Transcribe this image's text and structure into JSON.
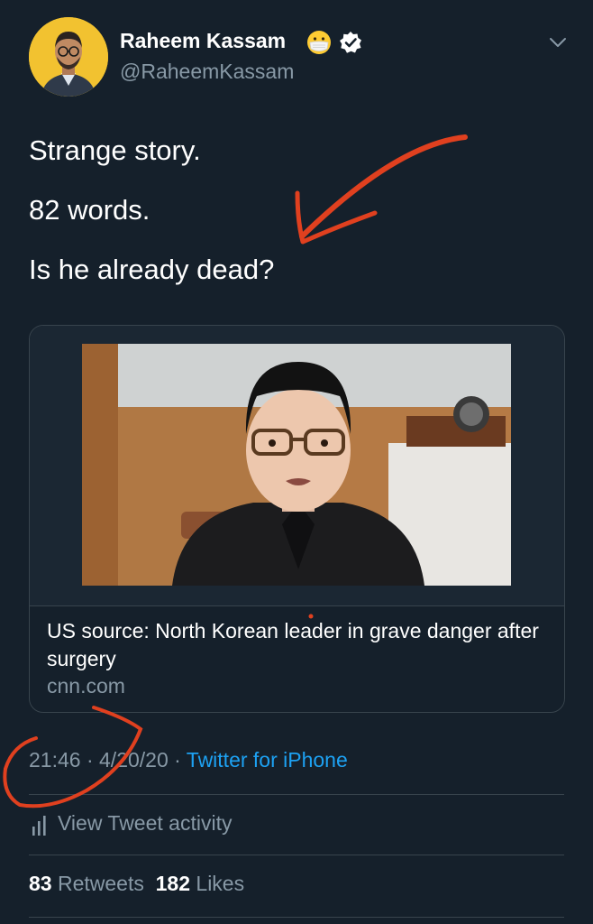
{
  "author": {
    "name": "Raheem Kassam",
    "handle": "@RaheemKassam"
  },
  "icons": {
    "emoji": "face-with-medical-mask-icon",
    "verified": "verified-badge-icon",
    "menu": "chevron-down-icon",
    "activity": "bar-chart-icon"
  },
  "tweet": {
    "lines": [
      "Strange story.",
      "82 words.",
      "Is he already dead?"
    ]
  },
  "card": {
    "title": "US source: North Korean leader in grave danger after surgery",
    "domain": "cnn.com"
  },
  "meta": {
    "time": "21:46",
    "separator": " · ",
    "date": "4/20/20",
    "source": "Twitter for iPhone"
  },
  "activity": {
    "label": "View Tweet activity"
  },
  "stats": {
    "retweets_count": "83",
    "retweets_label": "Retweets",
    "likes_count": "182",
    "likes_label": "Likes"
  },
  "colors": {
    "background": "#15202b",
    "secondary_text": "#8899a6",
    "link": "#1da1f2",
    "divider": "#38444d",
    "annotation": "#e0401f"
  }
}
